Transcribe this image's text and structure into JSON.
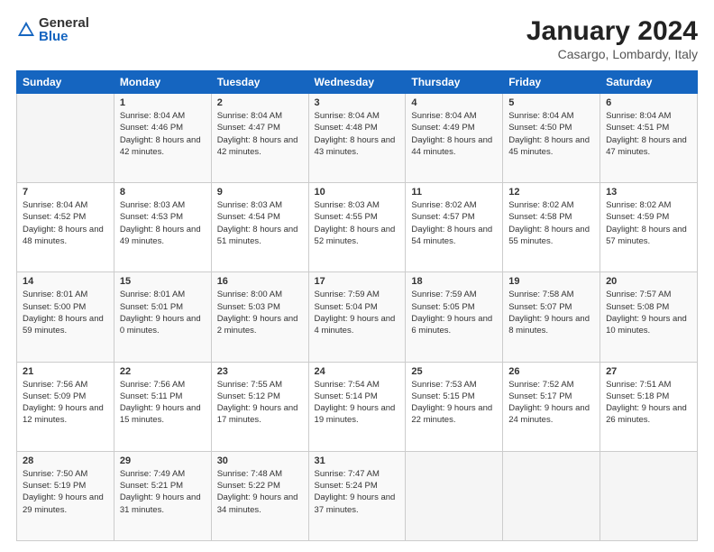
{
  "logo": {
    "general": "General",
    "blue": "Blue"
  },
  "title": "January 2024",
  "subtitle": "Casargo, Lombardy, Italy",
  "weekdays": [
    "Sunday",
    "Monday",
    "Tuesday",
    "Wednesday",
    "Thursday",
    "Friday",
    "Saturday"
  ],
  "weeks": [
    [
      {
        "day": "",
        "sunrise": "",
        "sunset": "",
        "daylight": ""
      },
      {
        "day": "1",
        "sunrise": "Sunrise: 8:04 AM",
        "sunset": "Sunset: 4:46 PM",
        "daylight": "Daylight: 8 hours and 42 minutes."
      },
      {
        "day": "2",
        "sunrise": "Sunrise: 8:04 AM",
        "sunset": "Sunset: 4:47 PM",
        "daylight": "Daylight: 8 hours and 42 minutes."
      },
      {
        "day": "3",
        "sunrise": "Sunrise: 8:04 AM",
        "sunset": "Sunset: 4:48 PM",
        "daylight": "Daylight: 8 hours and 43 minutes."
      },
      {
        "day": "4",
        "sunrise": "Sunrise: 8:04 AM",
        "sunset": "Sunset: 4:49 PM",
        "daylight": "Daylight: 8 hours and 44 minutes."
      },
      {
        "day": "5",
        "sunrise": "Sunrise: 8:04 AM",
        "sunset": "Sunset: 4:50 PM",
        "daylight": "Daylight: 8 hours and 45 minutes."
      },
      {
        "day": "6",
        "sunrise": "Sunrise: 8:04 AM",
        "sunset": "Sunset: 4:51 PM",
        "daylight": "Daylight: 8 hours and 47 minutes."
      }
    ],
    [
      {
        "day": "7",
        "sunrise": "Sunrise: 8:04 AM",
        "sunset": "Sunset: 4:52 PM",
        "daylight": "Daylight: 8 hours and 48 minutes."
      },
      {
        "day": "8",
        "sunrise": "Sunrise: 8:03 AM",
        "sunset": "Sunset: 4:53 PM",
        "daylight": "Daylight: 8 hours and 49 minutes."
      },
      {
        "day": "9",
        "sunrise": "Sunrise: 8:03 AM",
        "sunset": "Sunset: 4:54 PM",
        "daylight": "Daylight: 8 hours and 51 minutes."
      },
      {
        "day": "10",
        "sunrise": "Sunrise: 8:03 AM",
        "sunset": "Sunset: 4:55 PM",
        "daylight": "Daylight: 8 hours and 52 minutes."
      },
      {
        "day": "11",
        "sunrise": "Sunrise: 8:02 AM",
        "sunset": "Sunset: 4:57 PM",
        "daylight": "Daylight: 8 hours and 54 minutes."
      },
      {
        "day": "12",
        "sunrise": "Sunrise: 8:02 AM",
        "sunset": "Sunset: 4:58 PM",
        "daylight": "Daylight: 8 hours and 55 minutes."
      },
      {
        "day": "13",
        "sunrise": "Sunrise: 8:02 AM",
        "sunset": "Sunset: 4:59 PM",
        "daylight": "Daylight: 8 hours and 57 minutes."
      }
    ],
    [
      {
        "day": "14",
        "sunrise": "Sunrise: 8:01 AM",
        "sunset": "Sunset: 5:00 PM",
        "daylight": "Daylight: 8 hours and 59 minutes."
      },
      {
        "day": "15",
        "sunrise": "Sunrise: 8:01 AM",
        "sunset": "Sunset: 5:01 PM",
        "daylight": "Daylight: 9 hours and 0 minutes."
      },
      {
        "day": "16",
        "sunrise": "Sunrise: 8:00 AM",
        "sunset": "Sunset: 5:03 PM",
        "daylight": "Daylight: 9 hours and 2 minutes."
      },
      {
        "day": "17",
        "sunrise": "Sunrise: 7:59 AM",
        "sunset": "Sunset: 5:04 PM",
        "daylight": "Daylight: 9 hours and 4 minutes."
      },
      {
        "day": "18",
        "sunrise": "Sunrise: 7:59 AM",
        "sunset": "Sunset: 5:05 PM",
        "daylight": "Daylight: 9 hours and 6 minutes."
      },
      {
        "day": "19",
        "sunrise": "Sunrise: 7:58 AM",
        "sunset": "Sunset: 5:07 PM",
        "daylight": "Daylight: 9 hours and 8 minutes."
      },
      {
        "day": "20",
        "sunrise": "Sunrise: 7:57 AM",
        "sunset": "Sunset: 5:08 PM",
        "daylight": "Daylight: 9 hours and 10 minutes."
      }
    ],
    [
      {
        "day": "21",
        "sunrise": "Sunrise: 7:56 AM",
        "sunset": "Sunset: 5:09 PM",
        "daylight": "Daylight: 9 hours and 12 minutes."
      },
      {
        "day": "22",
        "sunrise": "Sunrise: 7:56 AM",
        "sunset": "Sunset: 5:11 PM",
        "daylight": "Daylight: 9 hours and 15 minutes."
      },
      {
        "day": "23",
        "sunrise": "Sunrise: 7:55 AM",
        "sunset": "Sunset: 5:12 PM",
        "daylight": "Daylight: 9 hours and 17 minutes."
      },
      {
        "day": "24",
        "sunrise": "Sunrise: 7:54 AM",
        "sunset": "Sunset: 5:14 PM",
        "daylight": "Daylight: 9 hours and 19 minutes."
      },
      {
        "day": "25",
        "sunrise": "Sunrise: 7:53 AM",
        "sunset": "Sunset: 5:15 PM",
        "daylight": "Daylight: 9 hours and 22 minutes."
      },
      {
        "day": "26",
        "sunrise": "Sunrise: 7:52 AM",
        "sunset": "Sunset: 5:17 PM",
        "daylight": "Daylight: 9 hours and 24 minutes."
      },
      {
        "day": "27",
        "sunrise": "Sunrise: 7:51 AM",
        "sunset": "Sunset: 5:18 PM",
        "daylight": "Daylight: 9 hours and 26 minutes."
      }
    ],
    [
      {
        "day": "28",
        "sunrise": "Sunrise: 7:50 AM",
        "sunset": "Sunset: 5:19 PM",
        "daylight": "Daylight: 9 hours and 29 minutes."
      },
      {
        "day": "29",
        "sunrise": "Sunrise: 7:49 AM",
        "sunset": "Sunset: 5:21 PM",
        "daylight": "Daylight: 9 hours and 31 minutes."
      },
      {
        "day": "30",
        "sunrise": "Sunrise: 7:48 AM",
        "sunset": "Sunset: 5:22 PM",
        "daylight": "Daylight: 9 hours and 34 minutes."
      },
      {
        "day": "31",
        "sunrise": "Sunrise: 7:47 AM",
        "sunset": "Sunset: 5:24 PM",
        "daylight": "Daylight: 9 hours and 37 minutes."
      },
      {
        "day": "",
        "sunrise": "",
        "sunset": "",
        "daylight": ""
      },
      {
        "day": "",
        "sunrise": "",
        "sunset": "",
        "daylight": ""
      },
      {
        "day": "",
        "sunrise": "",
        "sunset": "",
        "daylight": ""
      }
    ]
  ]
}
